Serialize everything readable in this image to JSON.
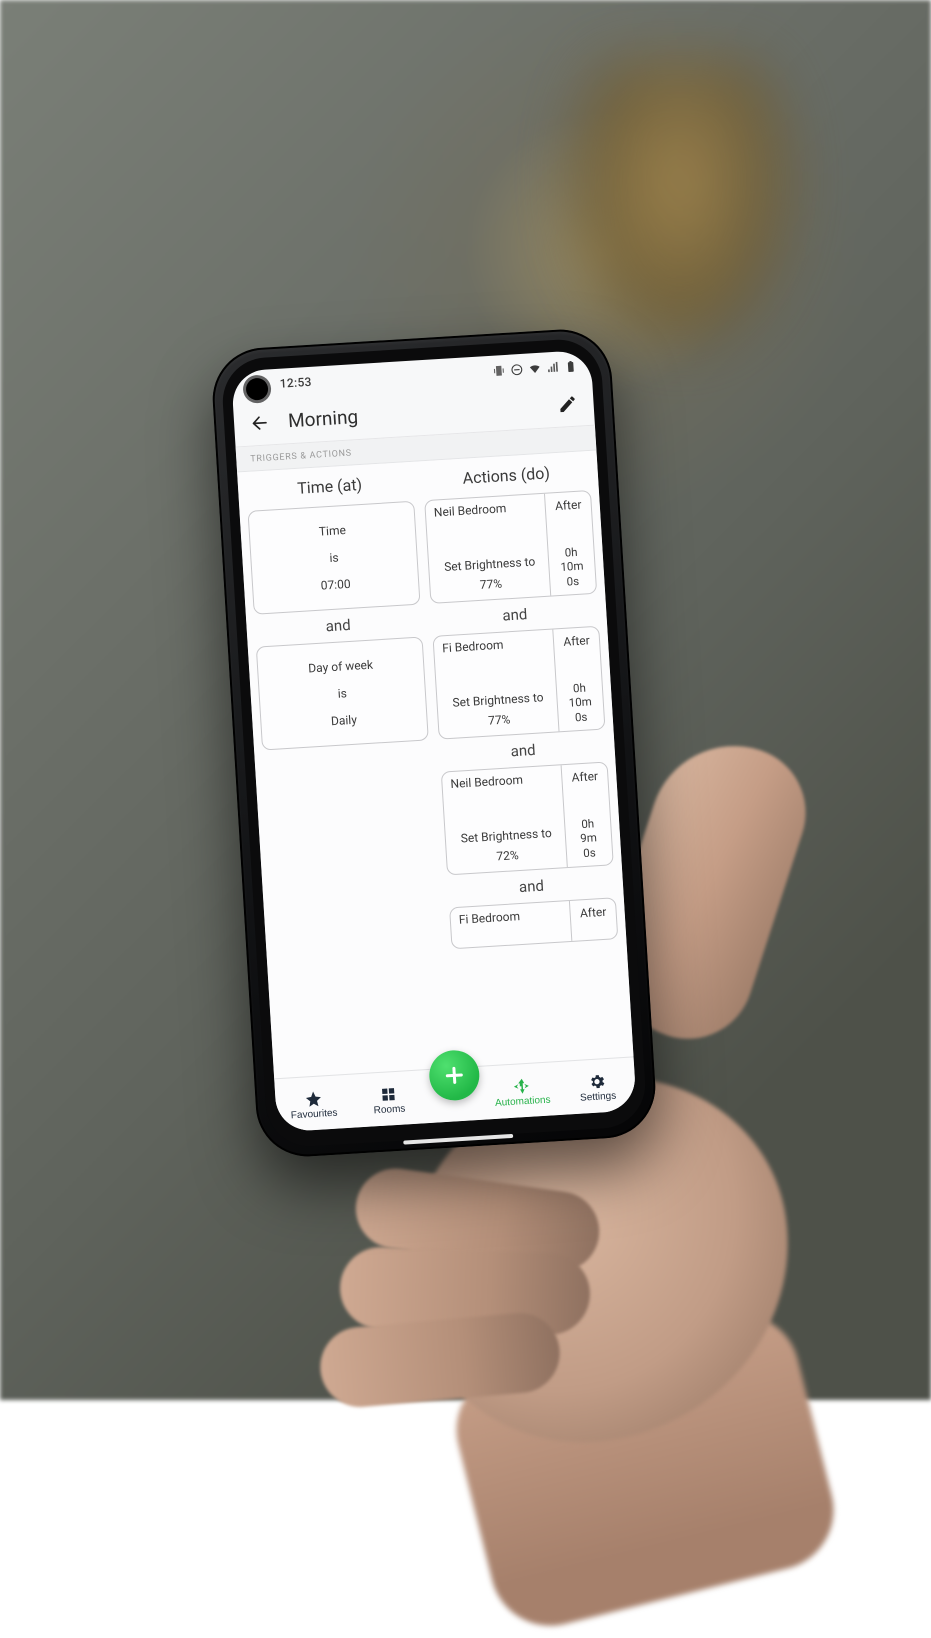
{
  "statusbar": {
    "time": "12:53"
  },
  "header": {
    "title": "Morning"
  },
  "section_label": "TRIGGERS & ACTIONS",
  "columns": {
    "triggers_header": "Time (at)",
    "actions_header": "Actions (do)",
    "joiner": "and"
  },
  "triggers": [
    {
      "field": "Time",
      "op": "is",
      "value": "07:00"
    },
    {
      "field": "Day of week",
      "op": "is",
      "value": "Daily"
    }
  ],
  "actions": [
    {
      "room": "Neil Bedroom",
      "setline": "Set Brightness to",
      "setval": "77%",
      "after_label": "After",
      "delay": "0h\n10m\n0s"
    },
    {
      "room": "Fi Bedroom",
      "setline": "Set Brightness to",
      "setval": "77%",
      "after_label": "After",
      "delay": "0h\n10m\n0s"
    },
    {
      "room": "Neil Bedroom",
      "setline": "Set Brightness to",
      "setval": "72%",
      "after_label": "After",
      "delay": "0h\n9m\n0s"
    },
    {
      "room": "Fi Bedroom",
      "setline": "",
      "setval": "",
      "after_label": "After",
      "delay": ""
    }
  ],
  "nav": {
    "favourites": "Favourites",
    "rooms": "Rooms",
    "automations": "Automations",
    "settings": "Settings"
  }
}
